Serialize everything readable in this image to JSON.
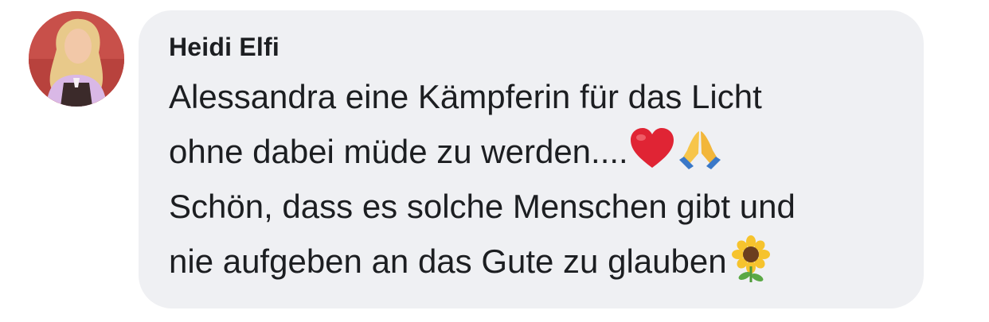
{
  "comment": {
    "author": "Heidi Elfi",
    "lines": [
      "Alessandra eine Kämpferin für das Licht",
      "ohne dabei müde zu werden....",
      "Schön, dass es solche Menschen gibt und",
      "nie aufgeben an das Gute zu glauben"
    ],
    "emojis": [
      "red-heart",
      "folded-hands",
      "sunflower"
    ]
  },
  "colors": {
    "bubble": "#eff0f3",
    "text": "#1c1e21",
    "avatar_bg": "#c8504a"
  }
}
